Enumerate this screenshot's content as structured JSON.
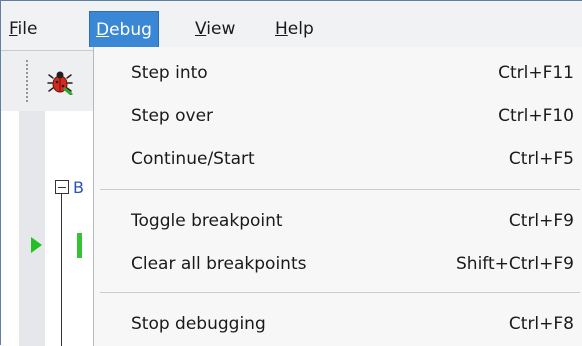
{
  "menubar": {
    "items": [
      {
        "mnemonic": "F",
        "rest": "ile"
      },
      {
        "mnemonic": "D",
        "rest": "ebug"
      },
      {
        "mnemonic": "V",
        "rest": "iew"
      },
      {
        "mnemonic": "H",
        "rest": "elp"
      }
    ],
    "active": "Debug"
  },
  "editor": {
    "code_char": "B"
  },
  "debug_menu": {
    "groups": [
      [
        {
          "label": "Step into",
          "shortcut": "Ctrl+F11"
        },
        {
          "label": "Step over",
          "shortcut": "Ctrl+F10"
        },
        {
          "label": "Continue/Start",
          "shortcut": "Ctrl+F5"
        }
      ],
      [
        {
          "label": "Toggle breakpoint",
          "shortcut": "Ctrl+F9"
        },
        {
          "label": "Clear all breakpoints",
          "shortcut": "Shift+Ctrl+F9"
        }
      ],
      [
        {
          "label": "Stop debugging",
          "shortcut": "Ctrl+F8"
        }
      ]
    ]
  },
  "colors": {
    "accent": "#3a87d6",
    "execution_arrow": "#22c022"
  },
  "icons": {
    "toolbar_debug": "debug-bug-icon"
  }
}
